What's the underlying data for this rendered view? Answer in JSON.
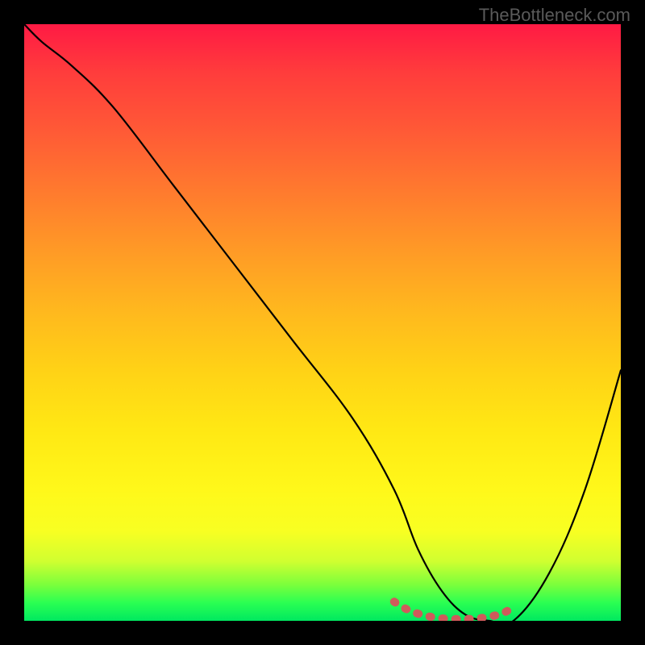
{
  "watermark": "TheBottleneck.com",
  "chart_data": {
    "type": "line",
    "title": "",
    "xlabel": "",
    "ylabel": "",
    "xlim": [
      0,
      100
    ],
    "ylim": [
      0,
      100
    ],
    "series": [
      {
        "name": "main-curve",
        "color": "#000000",
        "x": [
          0,
          3,
          8,
          15,
          25,
          35,
          45,
          55,
          62,
          66,
          70,
          74,
          78,
          82,
          88,
          94,
          100
        ],
        "y": [
          100,
          97,
          93,
          86,
          73,
          60,
          47,
          34,
          22,
          12,
          5,
          1,
          0,
          0,
          8,
          22,
          42
        ]
      },
      {
        "name": "bottom-marker",
        "color": "#d05858",
        "x": [
          62,
          64,
          66,
          68,
          70,
          72,
          74,
          76,
          78,
          80,
          82
        ],
        "y": [
          3.2,
          2.0,
          1.2,
          0.7,
          0.4,
          0.3,
          0.3,
          0.4,
          0.7,
          1.2,
          2.2
        ]
      }
    ]
  }
}
